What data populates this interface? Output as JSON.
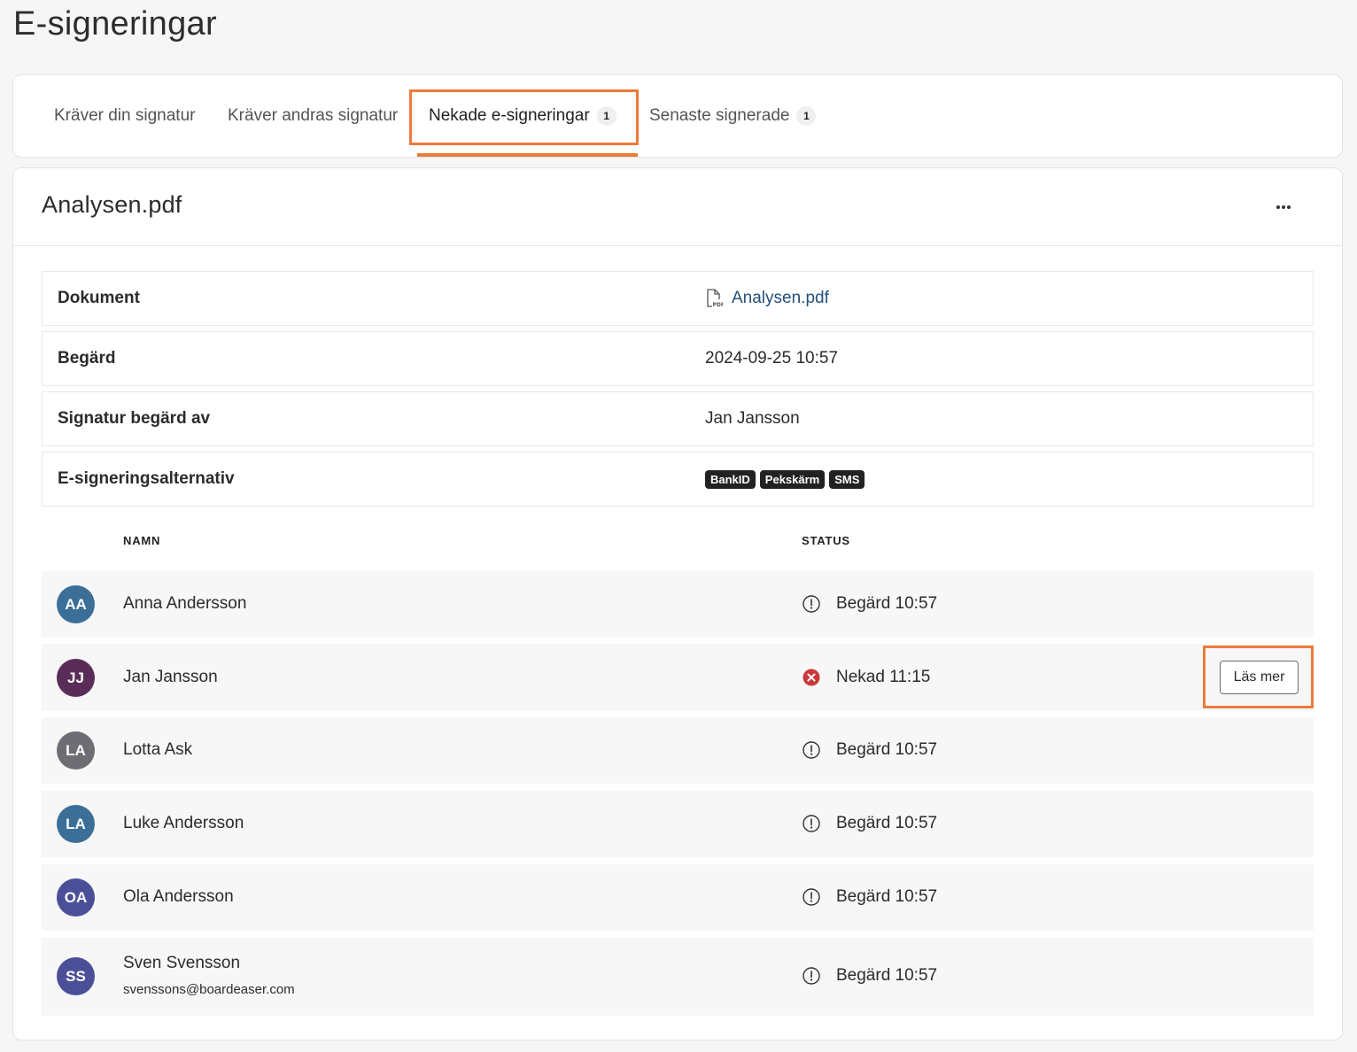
{
  "page": {
    "title": "E-signeringar"
  },
  "tabs": [
    {
      "label": "Kräver din signatur",
      "count": null
    },
    {
      "label": "Kräver andras signatur",
      "count": null
    },
    {
      "label": "Nekade e-signeringar",
      "count": "1",
      "active": true
    },
    {
      "label": "Senaste signerade",
      "count": "1"
    }
  ],
  "document": {
    "title": "Analysen.pdf",
    "more_icon": "ellipsis-icon",
    "info": {
      "document_label": "Dokument",
      "document_value": "Analysen.pdf",
      "document_icon": "pdf-file-icon",
      "requested_label": "Begärd",
      "requested_value": "2024-09-25 10:57",
      "requested_by_label": "Signatur begärd av",
      "requested_by_value": "Jan Jansson",
      "options_label": "E-signeringsalternativ",
      "options": [
        "BankID",
        "Pekskärm",
        "SMS"
      ]
    },
    "columns": {
      "name": "NAMN",
      "status": "STATUS"
    },
    "signers": [
      {
        "initials": "AA",
        "name": "Anna Andersson",
        "email": "",
        "status": "Begärd 10:57",
        "state": "pending",
        "avatar_color": "#3b6f98"
      },
      {
        "initials": "JJ",
        "name": "Jan Jansson",
        "email": "",
        "status": "Nekad 11:15",
        "state": "declined",
        "avatar_color": "#5a2d58",
        "action": "Läs mer"
      },
      {
        "initials": "LA",
        "name": "Lotta Ask",
        "email": "",
        "status": "Begärd 10:57",
        "state": "pending",
        "avatar_color": "#6d6d73"
      },
      {
        "initials": "LA",
        "name": "Luke Andersson",
        "email": "",
        "status": "Begärd 10:57",
        "state": "pending",
        "avatar_color": "#3b6f98"
      },
      {
        "initials": "OA",
        "name": "Ola Andersson",
        "email": "",
        "status": "Begärd 10:57",
        "state": "pending",
        "avatar_color": "#4a4f98"
      },
      {
        "initials": "SS",
        "name": "Sven Svensson",
        "email": "svenssons@boardeaser.com",
        "status": "Begärd 10:57",
        "state": "pending",
        "avatar_color": "#4a4f98"
      }
    ]
  },
  "colors": {
    "accent": "#ec7a3a",
    "declined": "#c9393c",
    "link": "#24507a"
  }
}
